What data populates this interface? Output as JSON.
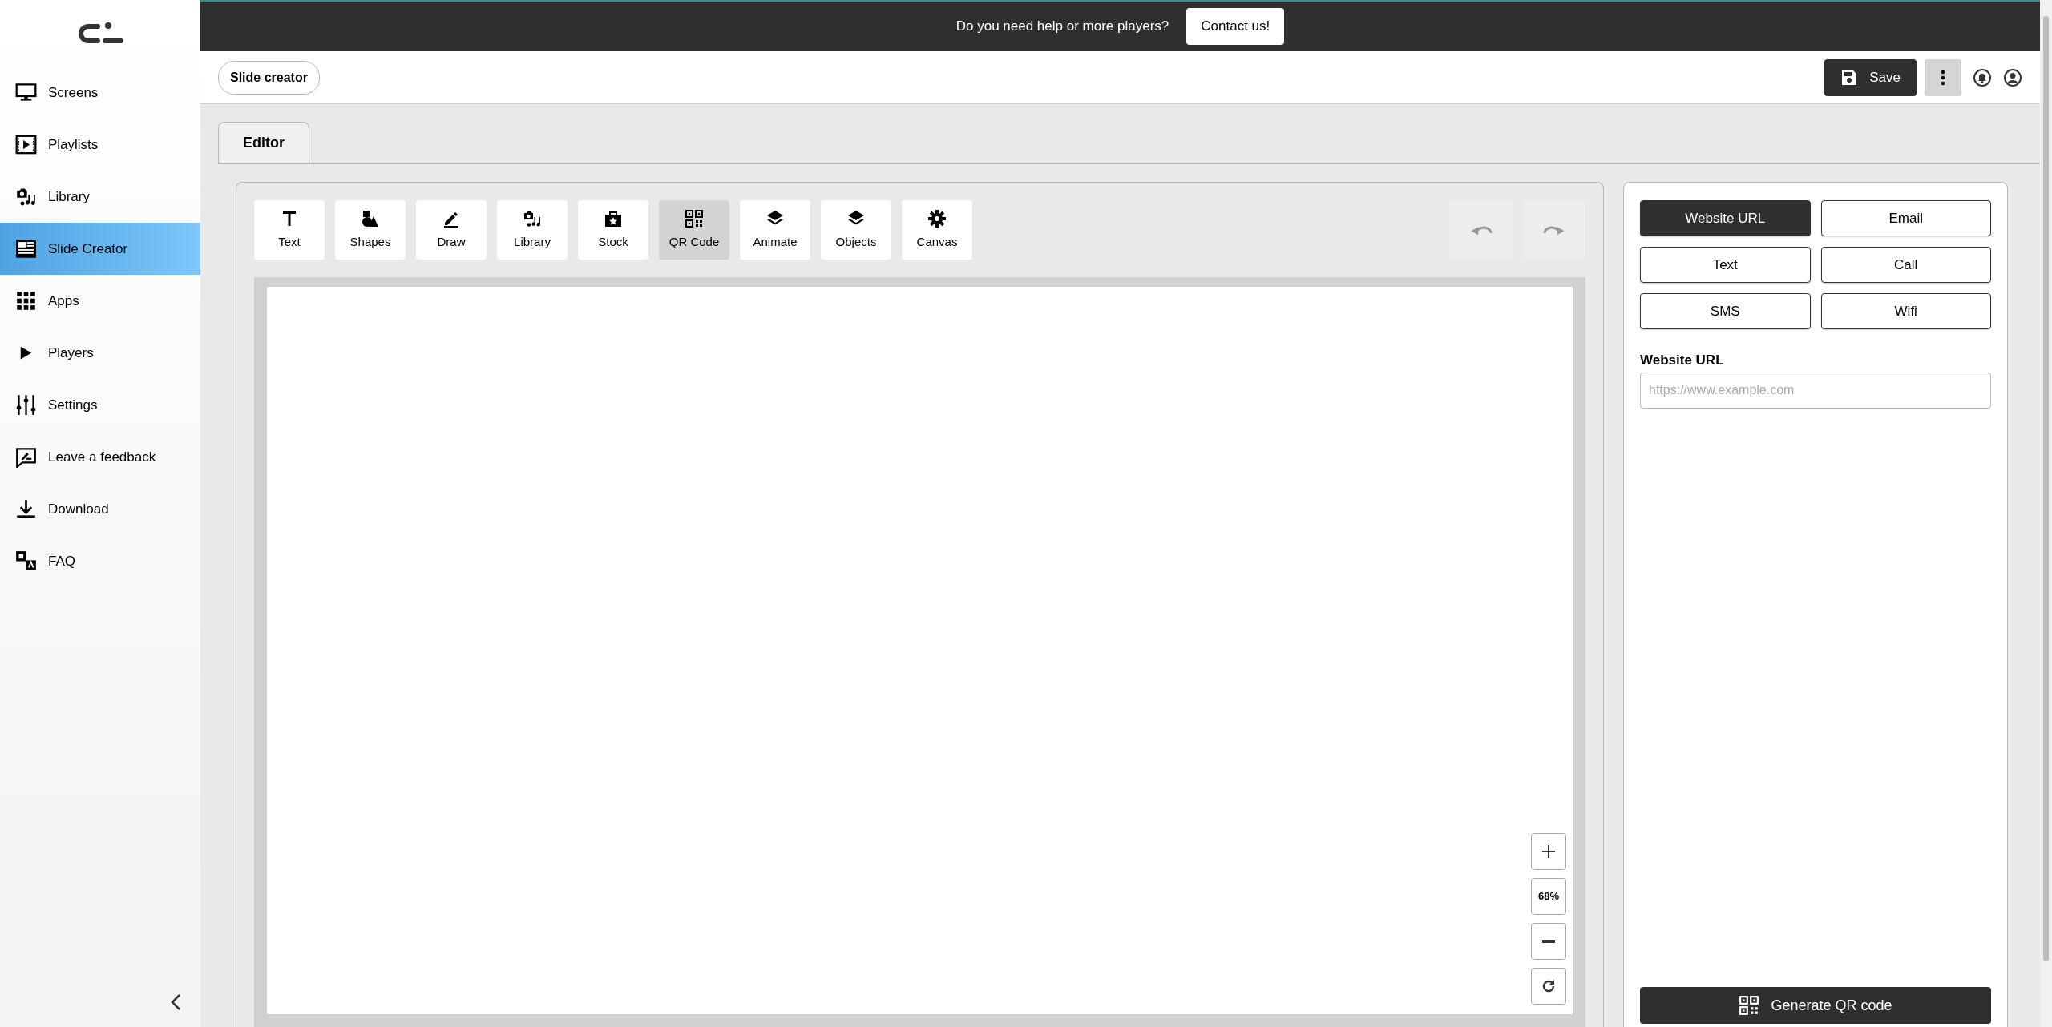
{
  "banner": {
    "text": "Do you need help or more players?",
    "button": "Contact us!"
  },
  "sidebar": {
    "items": [
      {
        "label": "Screens",
        "selected": false
      },
      {
        "label": "Playlists",
        "selected": false
      },
      {
        "label": "Library",
        "selected": false
      },
      {
        "label": "Slide Creator",
        "selected": true
      },
      {
        "label": "Apps",
        "selected": false
      },
      {
        "label": "Players",
        "selected": false
      },
      {
        "label": "Settings",
        "selected": false
      },
      {
        "label": "Leave a feedback",
        "selected": false
      },
      {
        "label": "Download",
        "selected": false
      },
      {
        "label": "FAQ",
        "selected": false
      }
    ]
  },
  "header": {
    "page_title": "Slide creator",
    "save_button": "Save"
  },
  "tabs": [
    {
      "label": "Editor",
      "selected": true
    }
  ],
  "toolbar": {
    "tools": [
      {
        "label": "Text",
        "selected": false
      },
      {
        "label": "Shapes",
        "selected": false
      },
      {
        "label": "Draw",
        "selected": false
      },
      {
        "label": "Library",
        "selected": false
      },
      {
        "label": "Stock",
        "selected": false
      },
      {
        "label": "QR Code",
        "selected": true
      },
      {
        "label": "Animate",
        "selected": false
      },
      {
        "label": "Objects",
        "selected": false
      },
      {
        "label": "Canvas",
        "selected": false
      }
    ],
    "undo": {
      "disabled": true
    },
    "redo": {
      "disabled": true
    }
  },
  "zoom": {
    "reading": "68%"
  },
  "qr_panel": {
    "types": [
      {
        "label": "Website URL",
        "selected": true
      },
      {
        "label": "Email",
        "selected": false
      },
      {
        "label": "Text",
        "selected": false
      },
      {
        "label": "Call",
        "selected": false
      },
      {
        "label": "SMS",
        "selected": false
      },
      {
        "label": "Wifi",
        "selected": false
      }
    ],
    "field_label": "Website URL",
    "placeholder": "https://www.example.com",
    "generate_button": "Generate QR code"
  }
}
